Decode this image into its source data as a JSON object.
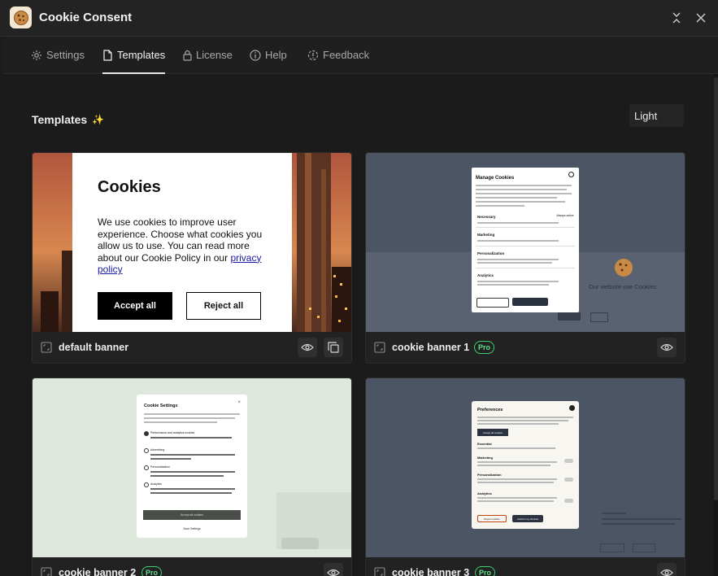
{
  "titlebar": {
    "title": "Cookie Consent"
  },
  "tabs": [
    {
      "label": "Settings",
      "icon": "gear-icon"
    },
    {
      "label": "Templates",
      "icon": "document-icon",
      "active": true
    },
    {
      "label": "License",
      "icon": "lock-icon"
    },
    {
      "label": "Help",
      "icon": "info-icon"
    },
    {
      "label": "Feedback",
      "icon": "feedback-icon"
    }
  ],
  "section": {
    "title": "Templates",
    "sparkle": "✨"
  },
  "theme_select": {
    "value": "Light"
  },
  "cards": [
    {
      "name": "default banner",
      "pro": false,
      "preview": {
        "title": "Cookies",
        "text": "We use cookies to improve user experience. Choose what cookies you allow us to use. You can read more about our Cookie Policy in our ",
        "link": "privacy policy",
        "accept": "Accept all",
        "reject": "Reject all"
      }
    },
    {
      "name": "cookie banner 1",
      "pro": true,
      "pro_label": "Pro",
      "preview": {
        "title": "Manage Cookies",
        "rows": [
          "Necessary",
          "Marketing",
          "Personalization",
          "Analytics"
        ],
        "badge": "Always active",
        "bg_text": "Our website use Cookies"
      }
    },
    {
      "name": "cookie banner 2",
      "pro": true,
      "pro_label": "Pro",
      "preview": {
        "title": "Cookie Settings",
        "rows": [
          "Performance and analytics cookies",
          "Advertising",
          "Personalization",
          "Analytics"
        ],
        "button": "Accept all cookies",
        "link": "Save Settings"
      }
    },
    {
      "name": "cookie banner 3",
      "pro": true,
      "pro_label": "Pro",
      "preview": {
        "title": "Preferences",
        "rows": [
          "Essential",
          "Marketing",
          "Personalization",
          "Analytics"
        ],
        "reject": "Reject cookies",
        "confirm": "Confirm my choices",
        "accept": "Accept all cookies"
      }
    }
  ],
  "colors": {
    "accent_green": "#3fcf6e",
    "dark_bg": "#1c1c1c",
    "panel": "#4b5563"
  }
}
